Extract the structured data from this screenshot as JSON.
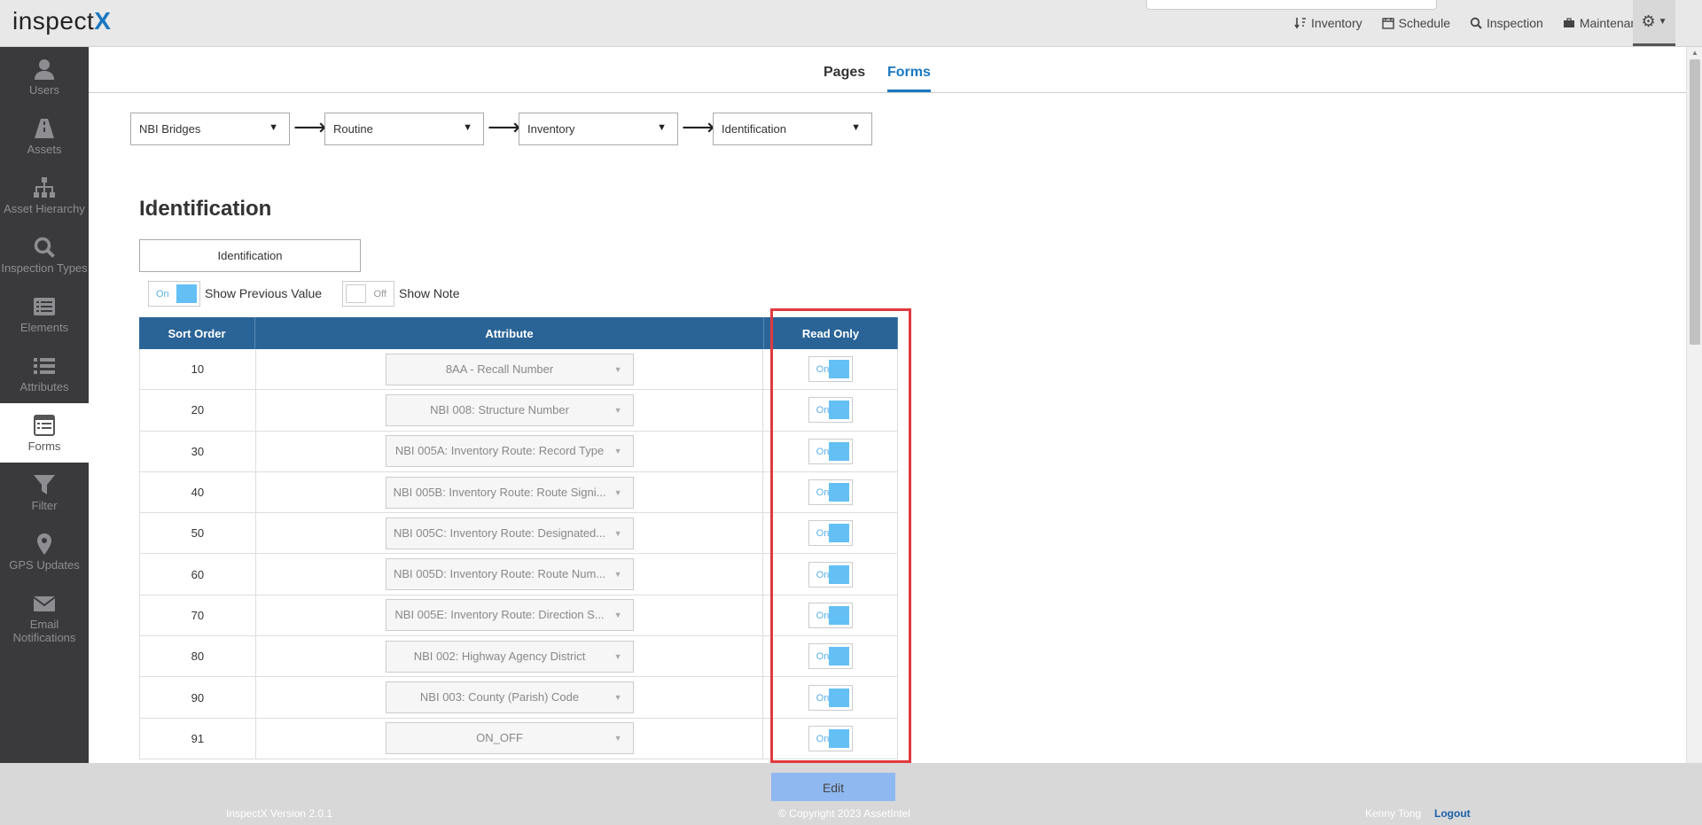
{
  "app": {
    "logo_text": "inspect",
    "logo_accent": "X"
  },
  "topnav": {
    "items": [
      {
        "label": "Inventory",
        "icon": "sort-icon"
      },
      {
        "label": "Schedule",
        "icon": "calendar-icon"
      },
      {
        "label": "Inspection",
        "icon": "search-icon"
      },
      {
        "label": "Maintenance",
        "icon": "toolbox-icon"
      }
    ],
    "settings_icon": "gear-icon"
  },
  "sidebar": {
    "items": [
      {
        "label": "Users",
        "icon": "user-icon"
      },
      {
        "label": "Assets",
        "icon": "road-icon"
      },
      {
        "label": "Asset Hierarchy",
        "icon": "sitemap-icon"
      },
      {
        "label": "Inspection Types",
        "icon": "search-icon"
      },
      {
        "label": "Elements",
        "icon": "list-alt-icon"
      },
      {
        "label": "Attributes",
        "icon": "list-icon"
      },
      {
        "label": "Forms",
        "icon": "form-icon",
        "active": true
      },
      {
        "label": "Filter",
        "icon": "filter-icon"
      },
      {
        "label": "GPS Updates",
        "icon": "map-marker-icon"
      },
      {
        "label": "Email Notifications",
        "icon": "envelope-icon"
      }
    ]
  },
  "tabs": {
    "pages": "Pages",
    "forms": "Forms",
    "active": "Forms"
  },
  "breadcrumb": {
    "selects": [
      "NBI Bridges",
      "Routine",
      "Inventory",
      "Identification"
    ],
    "arrow": "⟶"
  },
  "page_title": "Identification",
  "section_button": "Identification",
  "toggles": {
    "show_previous_value": {
      "state": "On",
      "label": "Show Previous Value"
    },
    "show_note": {
      "state": "Off",
      "label": "Show Note"
    }
  },
  "table": {
    "headers": {
      "sort_order": "Sort Order",
      "attribute": "Attribute",
      "read_only": "Read Only"
    },
    "rows": [
      {
        "sort": "10",
        "attribute": "8AA - Recall Number",
        "read_only": "On"
      },
      {
        "sort": "20",
        "attribute": "NBI 008: Structure Number",
        "read_only": "On"
      },
      {
        "sort": "30",
        "attribute": "NBI 005A: Inventory Route: Record Type",
        "read_only": "On"
      },
      {
        "sort": "40",
        "attribute": "NBI 005B: Inventory Route: Route Signi...",
        "read_only": "On"
      },
      {
        "sort": "50",
        "attribute": "NBI 005C: Inventory Route: Designated...",
        "read_only": "On"
      },
      {
        "sort": "60",
        "attribute": "NBI 005D: Inventory Route: Route Num...",
        "read_only": "On"
      },
      {
        "sort": "70",
        "attribute": "NBI 005E: Inventory Route: Direction S...",
        "read_only": "On"
      },
      {
        "sort": "80",
        "attribute": "NBI 002: Highway Agency District",
        "read_only": "On"
      },
      {
        "sort": "90",
        "attribute": "NBI 003: County (Parish) Code",
        "read_only": "On"
      },
      {
        "sort": "91",
        "attribute": "ON_OFF",
        "read_only": "On"
      }
    ]
  },
  "footer": {
    "edit_button": "Edit",
    "version": "InspectX Version 2.0.1",
    "copyright": "© Copyright 2023 AssetIntel",
    "user": "Kenny Tong",
    "logout": "Logout"
  },
  "colors": {
    "accent": "#1a78c2",
    "table_header": "#2a6496",
    "toggle_on": "#64bff5",
    "highlight": "#e03a3f",
    "sidebar": "#3a3a3d"
  }
}
